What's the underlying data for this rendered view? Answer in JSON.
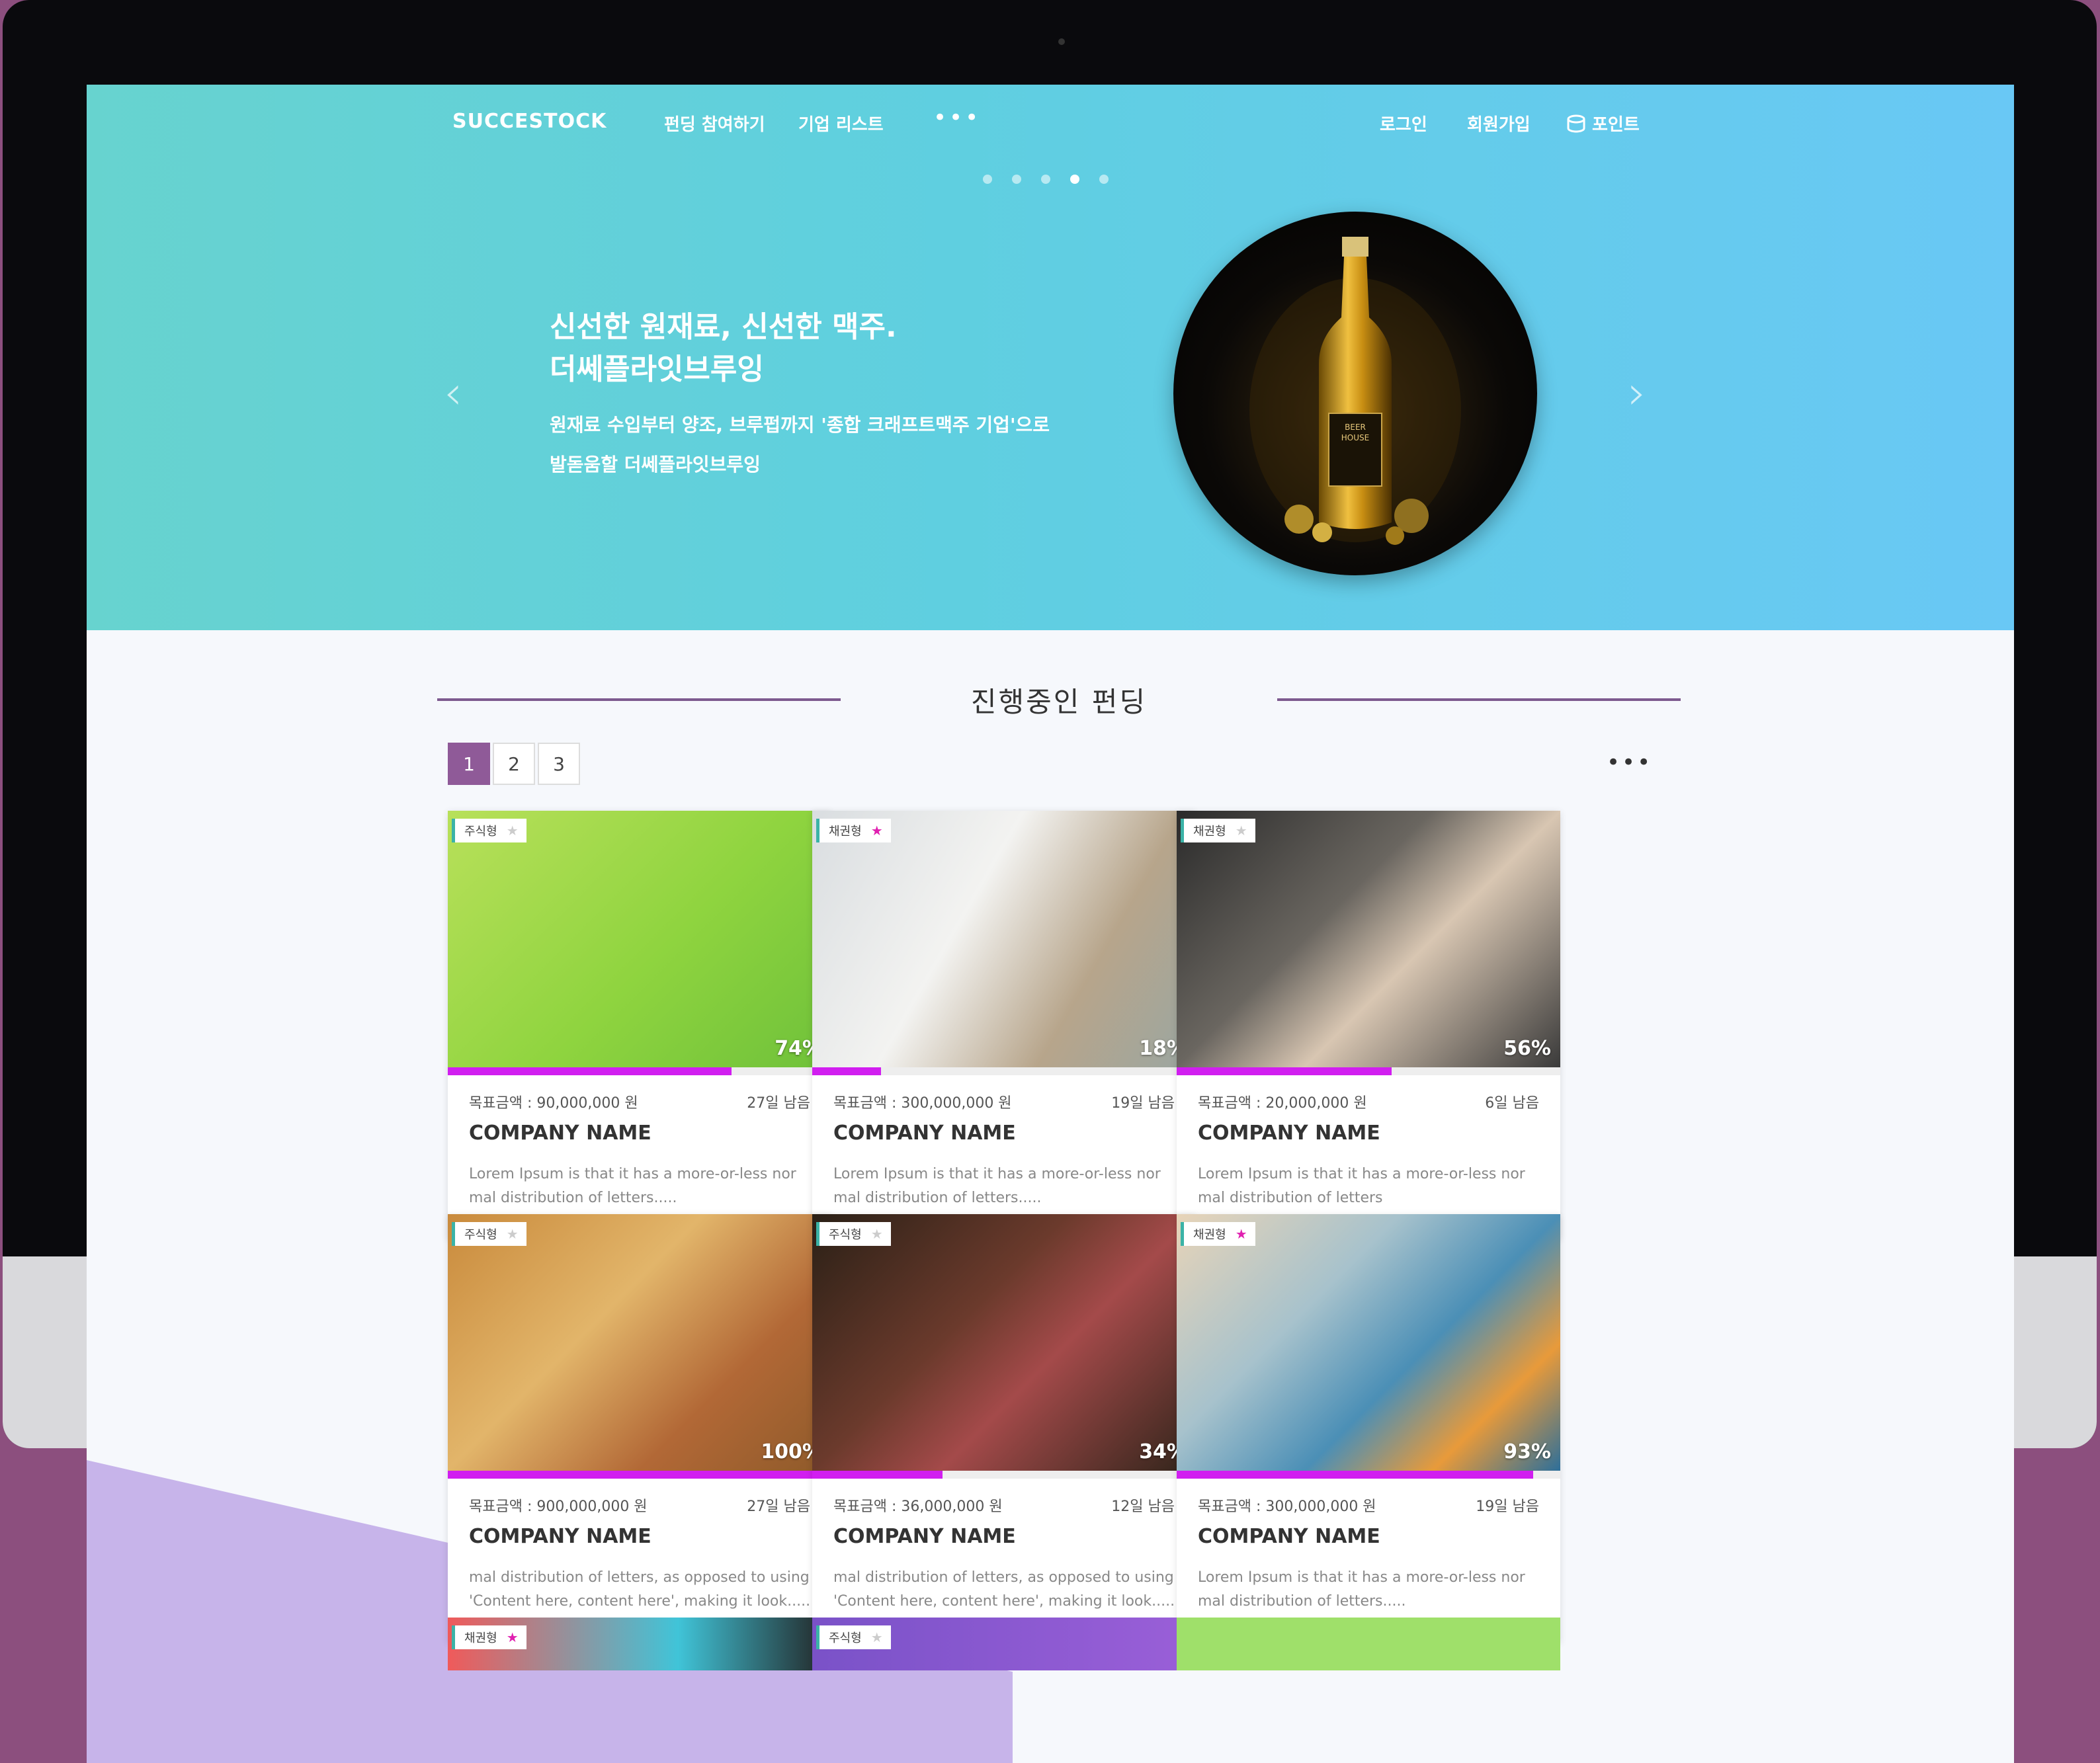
{
  "nav": {
    "logo": "SUCCESTOCK",
    "links": [
      "펀딩 참여하기",
      "기업 리스트"
    ],
    "more": "•••",
    "right": [
      "로그인",
      "회원가입",
      "포인트"
    ]
  },
  "hero": {
    "title": "신선한 원재료, 신선한 맥주.\n더쎄플라잇브루잉",
    "subtitle": "원재료 수입부터 양조, 브루펍까지 '종합 크래프트맥주 기업'으로\n발돋움할 더쎄플라잇브루잉",
    "prev": "‹",
    "next": "›",
    "slides": 5,
    "active_slide": 4
  },
  "section": {
    "title": "진행중인 펀딩",
    "pages": [
      "1",
      "2",
      "3"
    ],
    "active_page": "1",
    "more": "•••"
  },
  "colors": {
    "accent": "#d11ef0",
    "pager": "#8f5a98",
    "rule": "#7d5a8f"
  },
  "cards": [
    {
      "type": "주식형",
      "starred": false,
      "percent": "74%",
      "progress": 0.74,
      "goal": "목표금액 : 90,000,000 원",
      "days": "27일 남음",
      "name": "COMPANY NAME",
      "desc": "Lorem Ipsum is that it has a more-or-less nor mal distribution of letters.....",
      "image": "yellow-promo-woman"
    },
    {
      "type": "채권형",
      "starred": true,
      "percent": "18%",
      "progress": 0.18,
      "goal": "목표금액 : 300,000,000 원",
      "days": "19일 남음",
      "name": "COMPANY NAME",
      "desc": "Lorem Ipsum is that it has a more-or-less nor mal distribution of letters.....",
      "image": "white-interior-room"
    },
    {
      "type": "채권형",
      "starred": false,
      "percent": "56%",
      "progress": 0.56,
      "goal": "목표금액 : 20,000,000 원",
      "days": "6일 남음",
      "name": "COMPANY NAME",
      "desc": "Lorem Ipsum is that it has a more-or-less nor mal distribution of letters",
      "image": "coffee-milk-pour"
    },
    {
      "type": "주식형",
      "starred": false,
      "percent": "100%",
      "progress": 1.0,
      "goal": "목표금액 : 900,000,000 원",
      "days": "27일 남음",
      "name": "COMPANY NAME",
      "desc": "mal distribution of letters, as opposed to using 'Content here, content here', making it look.....",
      "image": "burgers-laughing-woman"
    },
    {
      "type": "주식형",
      "starred": false,
      "percent": "34%",
      "progress": 0.34,
      "goal": "목표금액 : 36,000,000 원",
      "days": "12일 남음",
      "name": "COMPANY NAME",
      "desc": "mal distribution of letters, as opposed to using 'Content here, content here', making it look.....",
      "image": "raw-steak"
    },
    {
      "type": "채권형",
      "starred": true,
      "percent": "93%",
      "progress": 0.93,
      "goal": "목표금액 : 300,000,000 원",
      "days": "19일 남음",
      "name": "COMPANY NAME",
      "desc": "Lorem Ipsum is that it has a more-or-less nor mal distribution of letters.....",
      "image": "beach-orange-drink"
    }
  ],
  "partial_cards": [
    {
      "type": "채권형",
      "starred": true
    },
    {
      "type": "주식형",
      "starred": false
    },
    {
      "type": "",
      "starred": false
    }
  ]
}
